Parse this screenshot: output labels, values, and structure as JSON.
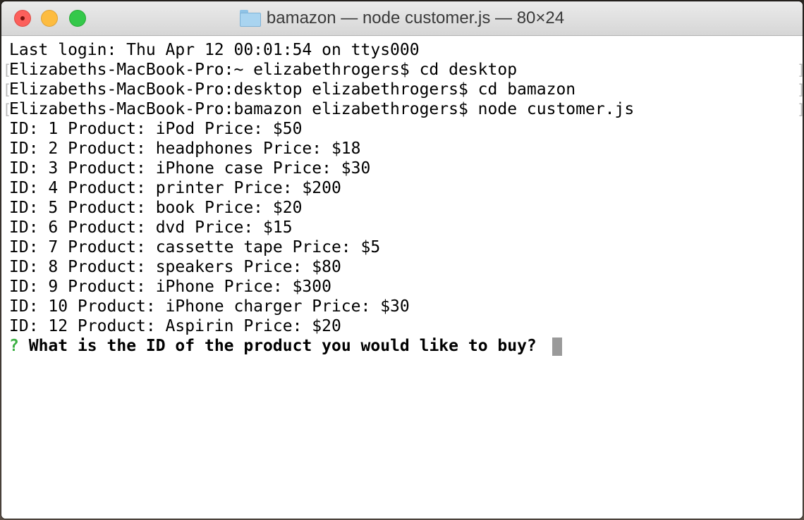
{
  "window": {
    "title": "bamazon — node customer.js — 80×24",
    "icon": "folder-icon"
  },
  "terminal": {
    "lines": [
      {
        "text": "Last login: Thu Apr 12 00:01:54 on ttys000",
        "marked": false
      },
      {
        "text": "Elizabeths-MacBook-Pro:~ elizabethrogers$ cd desktop",
        "marked": true
      },
      {
        "text": "Elizabeths-MacBook-Pro:desktop elizabethrogers$ cd bamazon",
        "marked": true
      },
      {
        "text": "Elizabeths-MacBook-Pro:bamazon elizabethrogers$ node customer.js",
        "marked": true
      },
      {
        "text": "ID: 1 Product: iPod Price: $50",
        "marked": false
      },
      {
        "text": "ID: 2 Product: headphones Price: $18",
        "marked": false
      },
      {
        "text": "ID: 3 Product: iPhone case Price: $30",
        "marked": false
      },
      {
        "text": "ID: 4 Product: printer Price: $200",
        "marked": false
      },
      {
        "text": "ID: 5 Product: book Price: $20",
        "marked": false
      },
      {
        "text": "ID: 6 Product: dvd Price: $15",
        "marked": false
      },
      {
        "text": "ID: 7 Product: cassette tape Price: $5",
        "marked": false
      },
      {
        "text": "ID: 8 Product: speakers Price: $80",
        "marked": false
      },
      {
        "text": "ID: 9 Product: iPhone Price: $300",
        "marked": false
      },
      {
        "text": "ID: 10 Product: iPhone charger Price: $30",
        "marked": false
      },
      {
        "text": "ID: 12 Product: Aspirin Price: $20",
        "marked": false
      }
    ],
    "prompt": {
      "marker": "?",
      "question": "What is the ID of the product you would like to buy?"
    },
    "line_marker_left": "[",
    "line_marker_right": "]"
  },
  "colors": {
    "prompt_marker": "#3cb043",
    "cursor": "#9a9a9a",
    "close": "#fc605c",
    "minimize": "#fdbc40",
    "zoom": "#34c84a"
  }
}
